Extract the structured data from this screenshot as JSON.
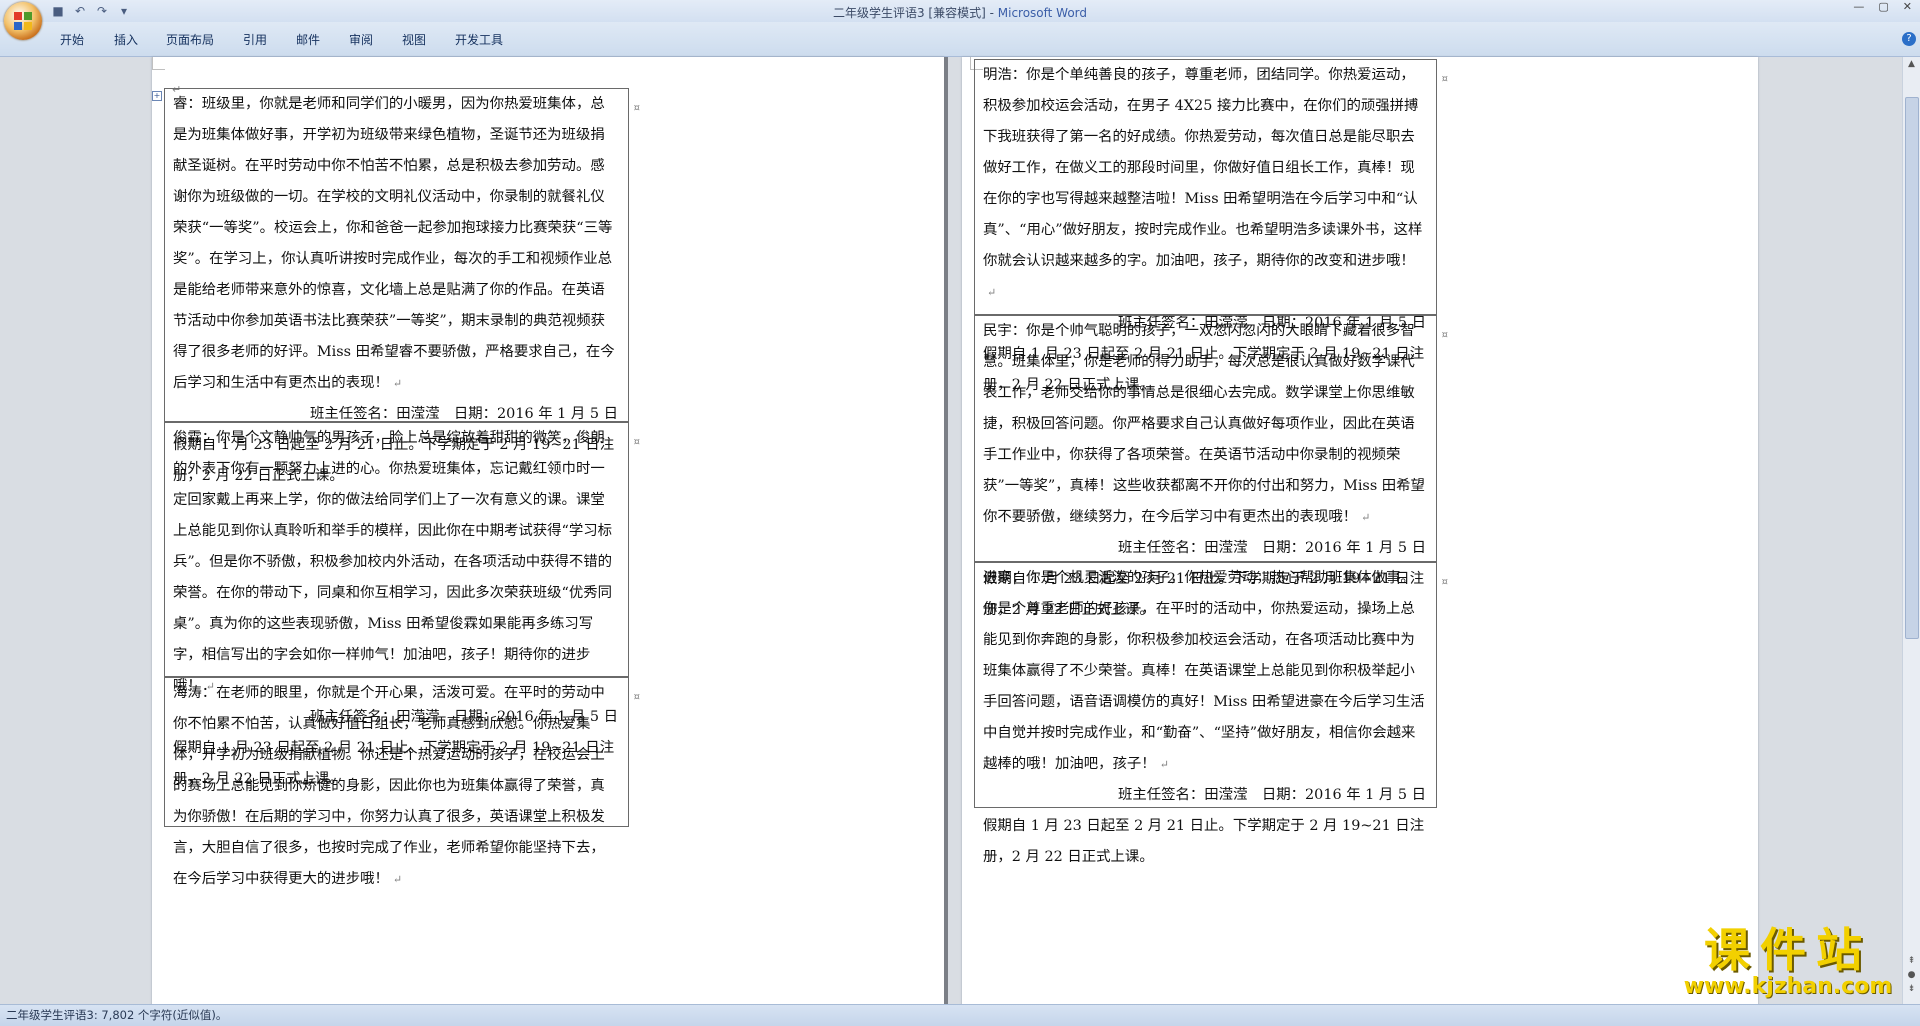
{
  "window": {
    "title": "二年级学生评语3 [兼容模式]",
    "separator": " - ",
    "app_name": "Microsoft Word",
    "minimize": "—",
    "maximize": "▢",
    "close": "✕"
  },
  "quick_access": [
    {
      "name": "save-icon",
      "glyph": "■"
    },
    {
      "name": "undo-icon",
      "glyph": "↶"
    },
    {
      "name": "redo-icon",
      "glyph": "↷"
    },
    {
      "name": "customize-icon",
      "glyph": "▾"
    }
  ],
  "ribbon": {
    "tabs": [
      "开始",
      "插入",
      "页面布局",
      "引用",
      "邮件",
      "审阅",
      "视图",
      "开发工具"
    ]
  },
  "document": {
    "left_page": [
      {
        "paragraphs": [
          "睿：班级里，你就是老师和同学们的小暖男，因为你热爱班集体，总是为班集体做好事，开学初为班级带来绿色植物，圣诞节还为班级捐献圣诞树。在平时劳动中你不怕苦不怕累，总是积极去参加劳动。感谢你为班级做的一切。在学校的文明礼仪活动中，你录制的就餐礼仪荣获“一等奖”。校运会上，你和爸爸一起参加抱球接力比赛荣获“三等奖”。在学习上，你认真听讲按时完成作业，每次的手工和视频作业总是能给老师带来意外的惊喜，文化墙上总是贴满了你的作品。在英语节活动中你参加英语书法比赛荣获”一等奖”，期末录制的典范视频获得了很多老师的好评。Miss 田希望睿不要骄傲，严格要求自己，在今后学习和生活中有更杰出的表现！"
        ],
        "signature": "班主任签名：田滢滢　日期：2016 年 1 月 5 日",
        "notice": "假期自 1 月 23 日起至 2 月 21 日止。下学期定于 2 月 19~21 日注册，2 月 22 日正式上课。"
      },
      {
        "paragraphs": [
          "俊霖：你是个文静帅气的男孩子，脸上总是绽放着甜甜的微笑，俊朗的外表下你有一颗努力上进的心。你热爱班集体，忘记戴红领巾时一定回家戴上再来上学，你的做法给同学们上了一次有意义的课。课堂上总能见到你认真聆听和举手的模样，因此你在中期考试获得“学习标兵”。但是你不骄傲，积极参加校内外活动，在各项活动中获得不错的荣誉。在你的带动下，同桌和你互相学习，因此多次荣获班级“优秀同桌”。真为你的这些表现骄傲，Miss 田希望俊霖如果能再多练习写字，相信写出的字会如你一样帅气！加油吧，孩子！期待你的进步哦！"
        ],
        "signature": "班主任签名：田滢滢　日期：2016 年 1 月 5 日",
        "notice": "假期自 1 月 23 日起至 2 月 21 日止。下学期定于 2 月 19~21 日注册，2 月 22 日正式上课。"
      },
      {
        "paragraphs": [
          "海涛：在老师的眼里，你就是个开心果，活泼可爱。在平时的劳动中你不怕累不怕苦，认真做好值日组长，老师真感到欣慰。你热爱集体，开学初为班级捐献植物。你还是个热爱运动的孩子，在校运会上的赛场上总能见到你矫健的身影，因此你也为班集体赢得了荣誉，真为你骄傲！在后期的学习中，你努力认真了很多，英语课堂上积极发言，大胆自信了很多，也按时完成了作业，老师希望你能坚持下去，在今后学习中获得更大的进步哦！"
        ],
        "signature": "",
        "notice": ""
      }
    ],
    "right_page": [
      {
        "paragraphs": [
          "明浩：你是个单纯善良的孩子，尊重老师，团结同学。你热爱运动，积极参加校运会活动，在男子 4X25 接力比赛中，在你们的顽强拼搏下我班获得了第一名的好成绩。你热爱劳动，每次值日总是能尽职去做好工作，在做义工的那段时间里，你做好值日组长工作，真棒！现在你的字也写得越来越整洁啦！Miss 田希望明浩在今后学习中和“认真”、“用心”做好朋友，按时完成作业。也希望明浩多读课外书，这样你就会认识越来越多的字。加油吧，孩子，期待你的改变和进步哦！"
        ],
        "signature": "班主任签名：田滢滢　日期：2016 年 1 月 5 日",
        "notice": "假期自 1 月 23 日起至 2 月 21 日止。下学期定于 2 月 19~21 日注册，2 月 22 日正式上课。"
      },
      {
        "paragraphs": [
          "民宇：你是个帅气聪明的孩子，一双忽闪忽闪的大眼睛下藏着很多智慧。班集体里，你是老师的得力助手，每次总是很认真做好数学课代表工作，老师交给你的事情总是很细心去完成。数学课堂上你思维敏捷，积极回答问题。你严格要求自己认真做好每项作业，因此在英语手工作业中，你获得了各项荣誉。在英语节活动中你录制的视频荣获”一等奖”，真棒！这些收获都离不开你的付出和努力，Miss 田希望你不要骄傲，继续努力，在今后学习中有更杰出的表现哦！"
        ],
        "signature": "班主任签名：田滢滢　日期：2016 年 1 月 5 日",
        "notice": "假期自 1 月 23 日起至 2 月 21 日止。下学期定于 2 月 19~21 日注册，2 月 22 日正式上课。"
      },
      {
        "paragraphs": [
          "进豪：你是个机灵活泼的孩子，你热爱劳动，热心帮助班集体做事。你是个尊重老师的好孩子，在平时的活动中，你热爱运动，操场上总能见到你奔跑的身影，你积极参加校运会活动，在各项活动比赛中为班集体赢得了不少荣誉。真棒！在英语课堂上总能见到你积极举起小手回答问题，语音语调模仿的真好！Miss 田希望进豪在今后学习生活中自觉并按时完成作业，和“勤奋”、“坚持”做好朋友，相信你会越来越棒的哦！加油吧，孩子！"
        ],
        "signature": "班主任签名：田滢滢　日期：2016 年 1 月 5 日",
        "notice": "假期自 1 月 23 日起至 2 月 21 日止。下学期定于 2 月 19~21 日注册，2 月 22 日正式上课。"
      }
    ]
  },
  "status_bar": {
    "text": "二年级学生评语3: 7,802 个字符(近似值)。"
  },
  "watermark": {
    "title": "课件站",
    "url": "www.kjzhan.com"
  }
}
